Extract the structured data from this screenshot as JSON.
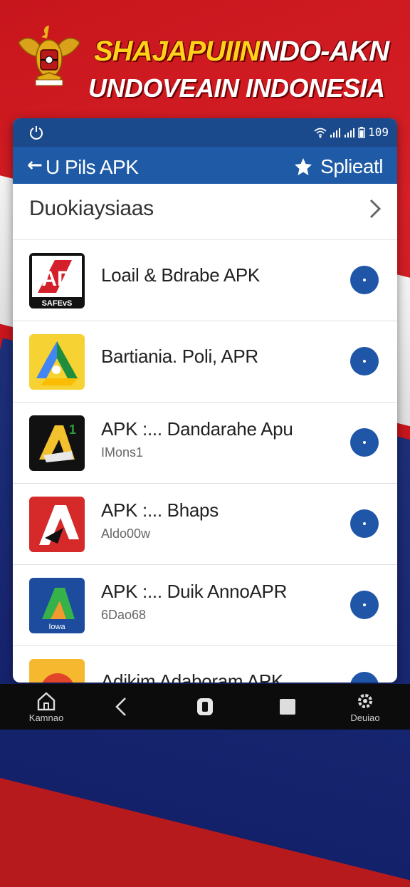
{
  "banner": {
    "line1_yellow": "SHAJAPUIIN",
    "line1_white": "NDO-AKN",
    "line2": "UNDOVEAIN INDONESIA"
  },
  "statusbar": {
    "signal_text": "್",
    "battery_text": "109"
  },
  "appbar": {
    "back_label": "←",
    "title": "U Pils APK",
    "action_label": "Splieatl"
  },
  "section": {
    "title": "Duokiaysiaas"
  },
  "apps": [
    {
      "name": "Loail & Bdrabe APK",
      "sub": ""
    },
    {
      "name": "Bartiania. Poli, APR",
      "sub": ""
    },
    {
      "name": "APK :... Dandarahe Apu",
      "sub": "IMons1"
    },
    {
      "name": "APK :... Bhaps",
      "sub": "Aldo00w"
    },
    {
      "name": "APK :... Duik AnnoAPR",
      "sub": "6Dao68"
    },
    {
      "name": "Adikim Adaboram APK",
      "sub": ""
    }
  ],
  "icon_texts": {
    "app1": "SAFEvS",
    "app5": "Iowa"
  },
  "navbar": {
    "home": "Kamnao",
    "settings": "Deuiao"
  },
  "colors": {
    "statusbar": "#1b4a8c",
    "appbar": "#1f5aa6",
    "download": "#1f56a8",
    "headline_yellow": "#ffd11a"
  }
}
